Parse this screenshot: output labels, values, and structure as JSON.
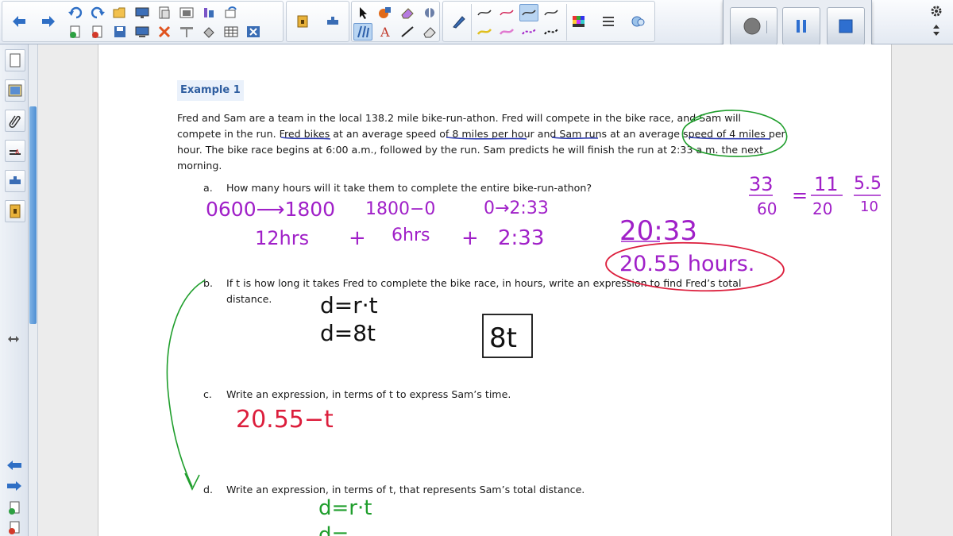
{
  "example_title": "Example 1",
  "problem": {
    "line1": "Fred and Sam are a team in the local 138.2 mile bike-run-athon.  Fred will compete in the bike race, and Sam will",
    "line2": "compete in the run.  Fred bikes at an average speed of 8 miles per hour and Sam runs at an average speed of 4 miles per",
    "line3": "hour.  The bike race begins at 6:00 a.m., followed by the run.  Sam predicts he will finish the run at 2:33 a.m. the next",
    "line4": "morning."
  },
  "questions": [
    {
      "letter": "a.",
      "text": "How many hours will it take them to complete the entire bike-run-athon?"
    },
    {
      "letter": "b.",
      "text": "If t is how long it takes Fred to complete the bike race, in hours, write an expression to find Fred’s total",
      "text2": "distance."
    },
    {
      "letter": "c.",
      "text": "Write an expression, in terms of t to express Sam’s time."
    },
    {
      "letter": "d.",
      "text": "Write an expression, in terms of t, that represents Sam’s total distance."
    }
  ],
  "handwriting": {
    "a_row1": [
      "0600⟶1800",
      "1800−0",
      "0→2:33"
    ],
    "a_row2": [
      "12hrs",
      "+",
      "6hrs",
      "+",
      "2:33"
    ],
    "a_total": "20:33",
    "a_answer": "20.55 hours.",
    "fraction_parts": [
      "33",
      "60",
      "=",
      "11",
      "20",
      "5.5",
      "10"
    ],
    "b_line1": "d=r·t",
    "b_line2": "d=8t",
    "b_answer": "8t",
    "c_answer": "20.55−t",
    "d_line1": "d=r·t",
    "d_line2": "d="
  },
  "icons": {
    "toolbar": [
      "back-arrow-icon",
      "forward-arrow-icon",
      "undo-icon",
      "redo-icon",
      "open-icon",
      "screen-icon",
      "paste-icon",
      "image-icon",
      "tools-icon",
      "redo-page-icon",
      "new-page-icon",
      "delete-page-icon",
      "save-icon",
      "display-icon",
      "delete-icon",
      "screen-shade-icon",
      "fill-icon",
      "table-icon",
      "close-box-icon",
      "lock-icon",
      "add-on-icon",
      "select-icon",
      "shape-icon",
      "eraser-icon",
      "magic-pen-icon",
      "creative-pen-icon",
      "text-icon",
      "line-icon",
      "erase-icon",
      "pen-icon",
      "color-icon",
      "properties-icon",
      "gallery-icon"
    ],
    "recorder": [
      "record-icon",
      "pause-icon",
      "stop-icon"
    ],
    "sidebar": [
      "page-sorter-icon",
      "gallery-icon",
      "attachments-icon",
      "properties-icon",
      "add-ons-icon",
      "lesson-icon"
    ]
  },
  "colors": {
    "ink_purple": "#a020c8",
    "ink_red": "#dc1e3c",
    "ink_green": "#1f9e2c",
    "ink_blue": "#3240b4",
    "ink_black": "#111111",
    "title_blue": "#2f5ea0",
    "title_bg": "#eaf1fb"
  }
}
